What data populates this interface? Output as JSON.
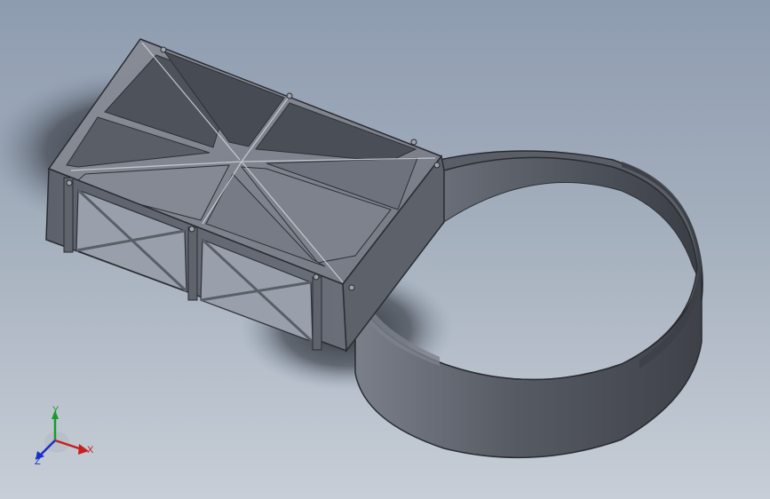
{
  "viewport": {
    "background_top": "#8e9cb0",
    "background_bottom": "#c7ced7"
  },
  "model": {
    "part_color": "#6d717c",
    "shadow_color": "#3a3e46"
  },
  "triad": {
    "x_label": "X",
    "y_label": "Y",
    "z_label": "Z",
    "x_color": "#c81e1e",
    "y_color": "#1a9a2a",
    "z_color": "#1a2ec8"
  }
}
